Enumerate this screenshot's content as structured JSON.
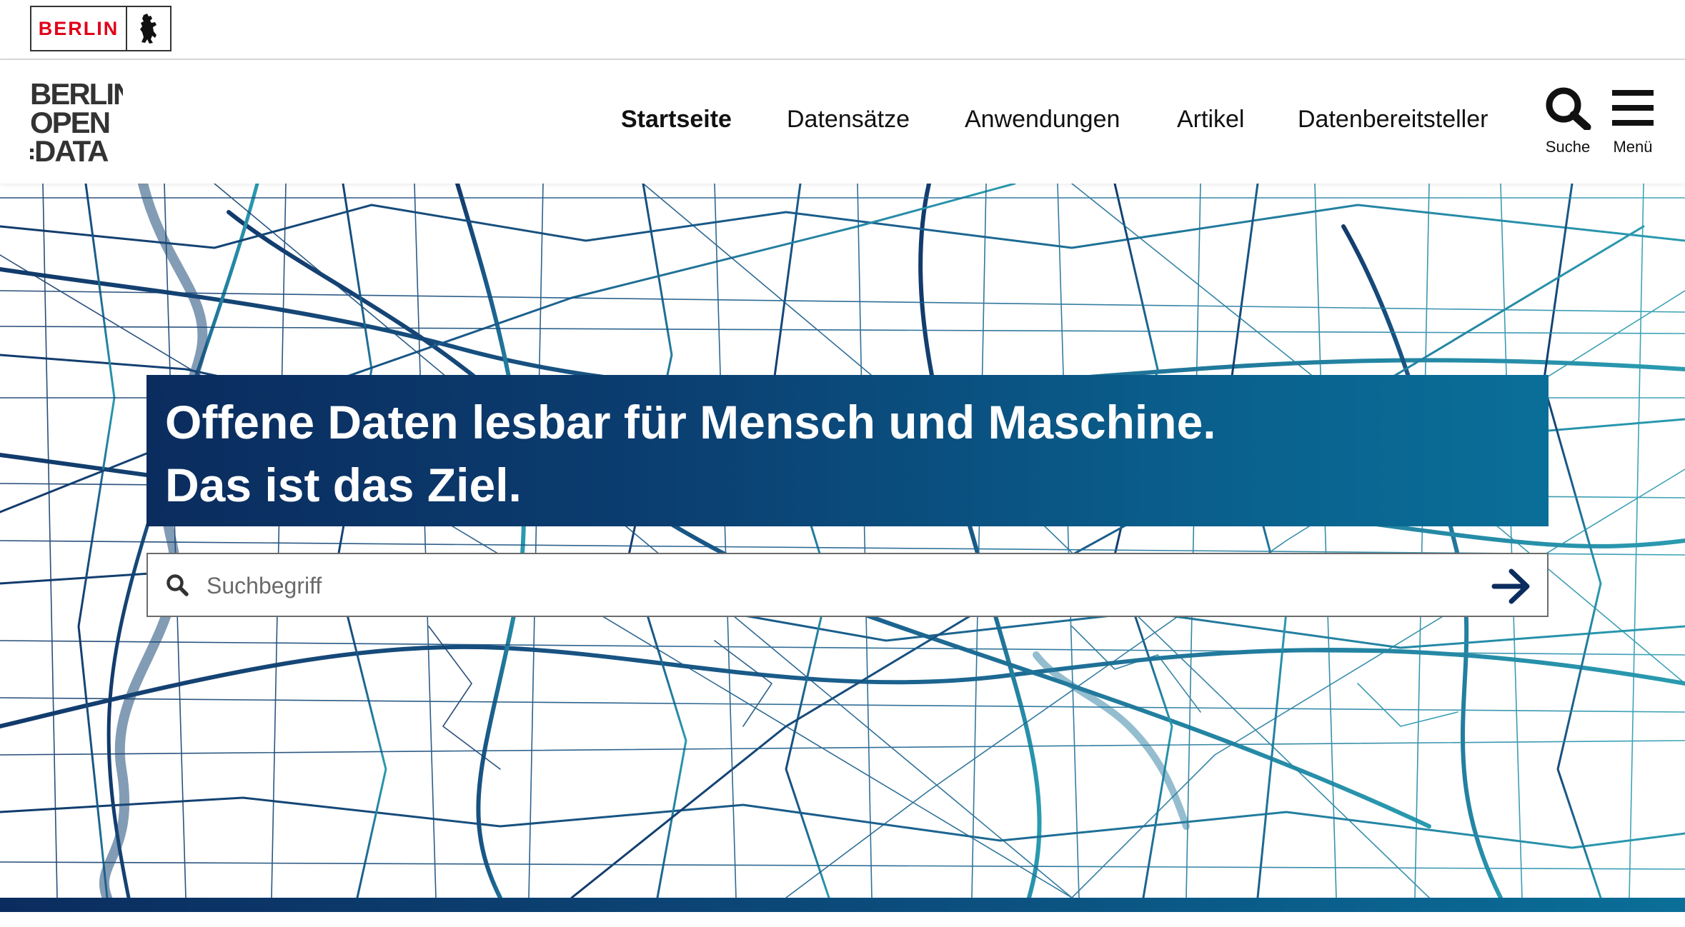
{
  "berlin_badge": {
    "label": "BERLIN",
    "icon": "berlin-bear-icon"
  },
  "header": {
    "logo_lines": [
      "BERLIN",
      "OPEN",
      "DATA"
    ],
    "nav": [
      {
        "label": "Startseite",
        "active": true
      },
      {
        "label": "Datensätze",
        "active": false
      },
      {
        "label": "Anwendungen",
        "active": false
      },
      {
        "label": "Artikel",
        "active": false
      },
      {
        "label": "Datenbereitsteller",
        "active": false
      }
    ],
    "search_button": {
      "label": "Suche",
      "icon": "search-icon"
    },
    "menu_button": {
      "label": "Menü",
      "icon": "hamburger-menu-icon"
    }
  },
  "hero": {
    "headline_line1": "Offene Daten lesbar für Mensch und Maschine.",
    "headline_line2": "Das ist das Ziel.",
    "search_placeholder": "Suchbegriff",
    "search_icon": "search-icon",
    "submit_icon": "arrow-right-icon",
    "colors": {
      "dark_blue": "#0b2c5e",
      "teal": "#0a6f98",
      "brand_red": "#e2001a"
    }
  }
}
